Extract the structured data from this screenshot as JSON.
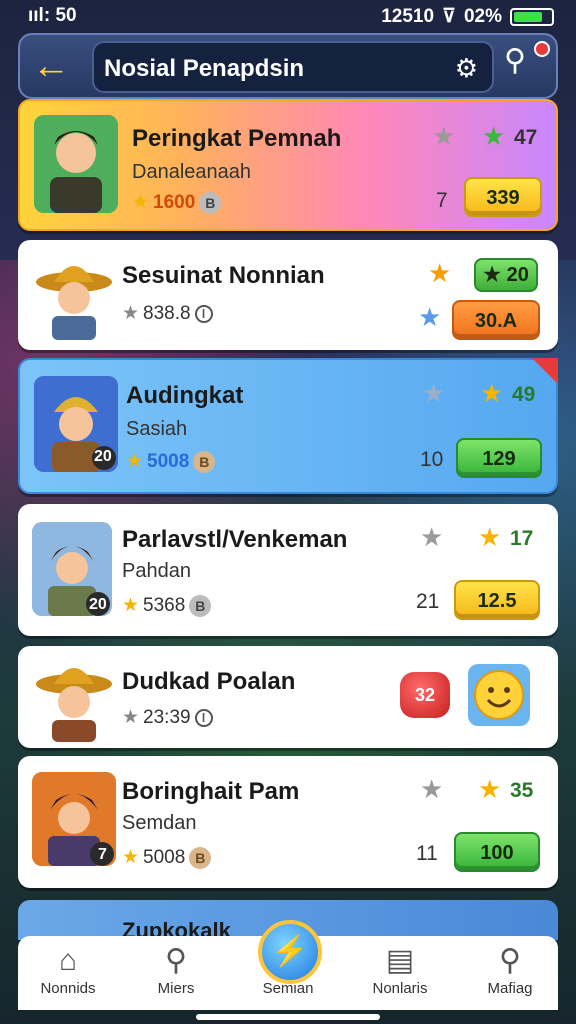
{
  "status": {
    "left": "ııl: 50",
    "time": "12510",
    "battery_text": "02%"
  },
  "header": {
    "title": "Nosial Penapdsin"
  },
  "cards": [
    {
      "name": "Peringkat Pemnah",
      "sub": "Danaleanaah",
      "points": "1600",
      "star_val": "47",
      "num": "7",
      "button": "339"
    },
    {
      "name": "Sesuinat Nonnian",
      "points": "838.8",
      "chip": "20",
      "button": "30.A"
    },
    {
      "name": "Audingkat",
      "sub": "Sasiah",
      "points": "5008",
      "badge": "20",
      "star_val": "49",
      "num": "10",
      "button": "129"
    },
    {
      "name": "Parlavstl/Venkeman",
      "sub": "Pahdan",
      "points": "5368",
      "badge": "20",
      "star_val": "17",
      "num": "21",
      "button": "12.5"
    },
    {
      "name": "Dudkad Poalan",
      "points": "23:39",
      "heart_val": "32"
    },
    {
      "name": "Boringhait Pam",
      "sub": "Semdan",
      "points": "5008",
      "badge": "7",
      "star_val": "35",
      "num": "11",
      "button": "100"
    },
    {
      "name": "Zupkokalk"
    }
  ],
  "nav": [
    {
      "label": "Nonnids",
      "icon": "home-icon"
    },
    {
      "label": "Miers",
      "icon": "whistle-icon"
    },
    {
      "label": "Semian",
      "icon": "lightning-icon"
    },
    {
      "label": "Nonlaris",
      "icon": "notes-icon"
    },
    {
      "label": "Mafiag",
      "icon": "magnifier-icon"
    }
  ],
  "colors": {
    "header": "#263863",
    "gold": "#ffd23a",
    "green_button": "#34b33a",
    "yellow_button": "#f6b617",
    "orange_button": "#f0711a"
  }
}
